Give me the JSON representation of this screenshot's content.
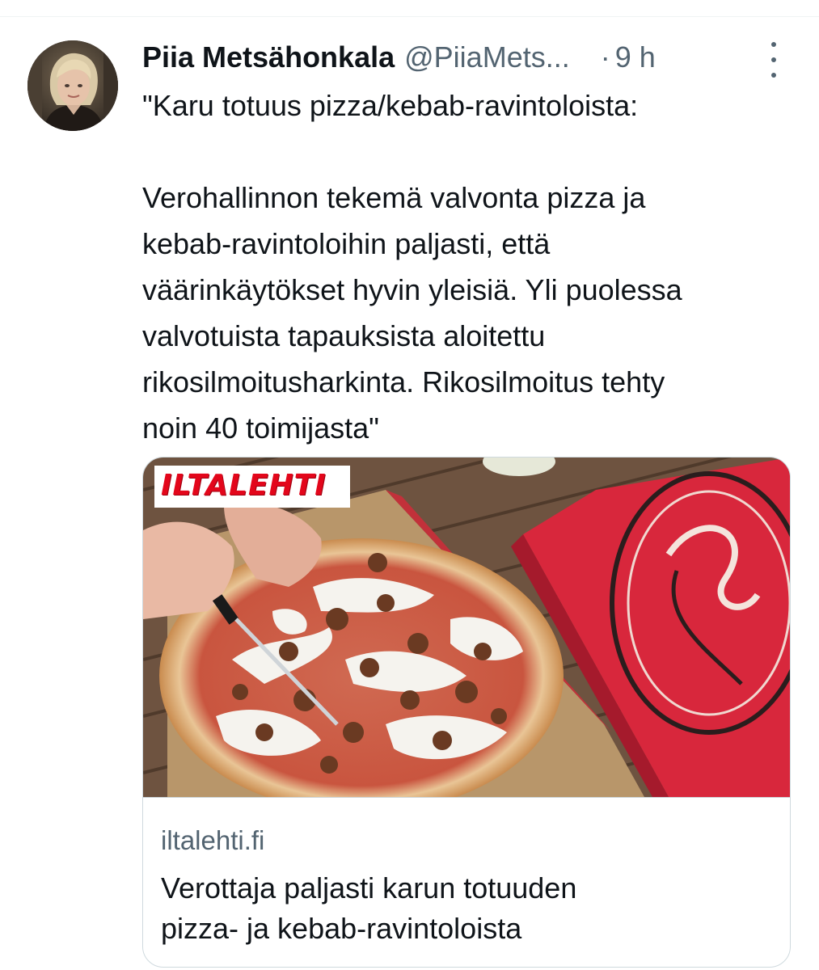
{
  "tweet": {
    "author": {
      "display_name": "Piia Metsähonkala",
      "handle": "@PiiaMets...",
      "time_separator": "·",
      "time": "9 h"
    },
    "text_lines": [
      "\"Karu totuus pizza/kebab-ravintoloista:",
      "Verohallinnon tekemä valvonta pizza ja",
      "kebab-ravintoloihin paljasti, että",
      "väärinkäytökset hyvin yleisiä. Yli puolessa",
      "valvotuista tapauksista aloitettu",
      "rikosilmoitusharkinta. Rikosilmoitus tehty",
      "noin 40 toimijasta\""
    ],
    "card": {
      "brand_logo": "ILTALEHTI",
      "domain": "iltalehti.fi",
      "title_line1": "Verottaja paljasti karun totuuden",
      "title_line2": "pizza- ja kebab-ravintoloista",
      "image_subject": "kebab pizza being cut next to red pizza box"
    },
    "icons": {
      "more": "more-vertical-icon"
    },
    "colors": {
      "text_primary": "#0f1419",
      "text_secondary": "#536471",
      "border": "#cfd9de",
      "brand_red": "#e3061b"
    }
  }
}
